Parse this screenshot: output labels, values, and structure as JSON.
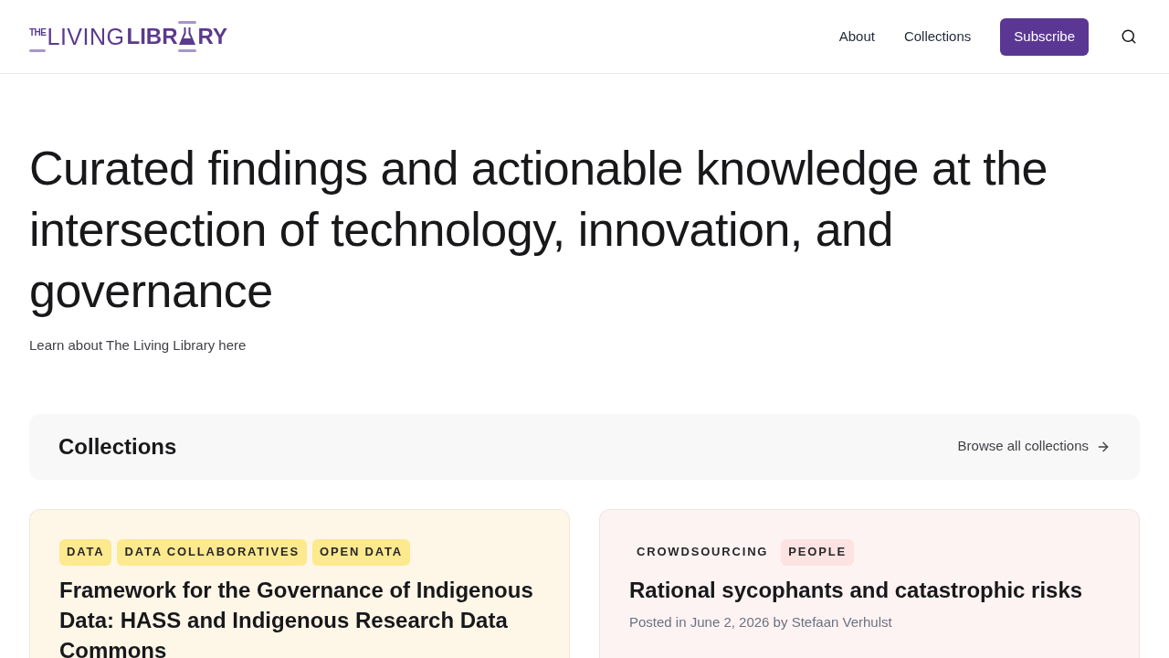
{
  "header": {
    "logo": {
      "prefix": "THE",
      "light": "LIVING",
      "bold_start": "LIBR",
      "bold_end": "RY"
    },
    "nav": [
      {
        "label": "About"
      },
      {
        "label": "Collections"
      }
    ],
    "subscribe": "Subscribe"
  },
  "hero": {
    "heading": "Curated findings and actionable knowledge at the intersection of technology, innovation, and governance",
    "intro": "Learn about The Living Library here"
  },
  "collections": {
    "title": "Collections",
    "browse_link": "Browse all collections"
  },
  "cards": [
    {
      "color": "#fef7e8",
      "tags": [
        {
          "label": "DATA",
          "color": "#fde98e"
        },
        {
          "label": "DATA COLLABORATIVES",
          "color": "#fde98e"
        },
        {
          "label": "OPEN DATA",
          "color": "#fde98e"
        }
      ],
      "title": "Framework for the Governance of Indigenous Data: HASS and Indigenous Research Data Commons"
    },
    {
      "color": "#fef3f3",
      "tags": [
        {
          "label": "CROWDSOURCING",
          "color": "#fef3f3"
        },
        {
          "label": "PEOPLE",
          "color": "#fde2e2"
        }
      ],
      "title": "Rational sycophants and catastrophic risks",
      "byline": "Posted in June 2, 2026 by Stefaan Verhulst"
    }
  ]
}
